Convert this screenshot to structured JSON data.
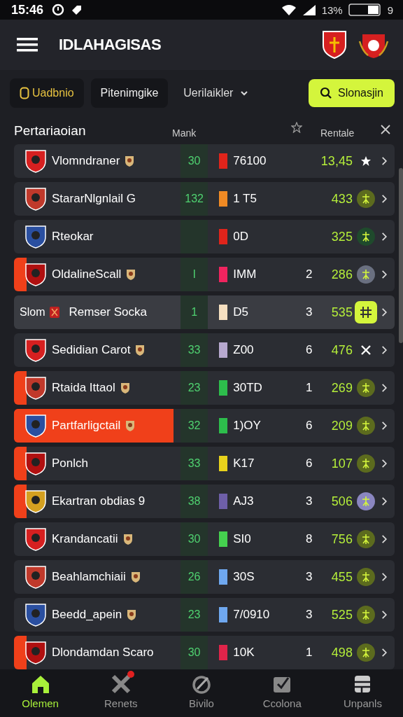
{
  "status_bar": {
    "time": "15:46",
    "battery_percent": "13%",
    "battery_digit": "9"
  },
  "header": {
    "title": "IDLAHAGISAS"
  },
  "filters": [
    {
      "label": "Uadbnio",
      "selected": true,
      "kind": "chip"
    },
    {
      "label": "Pitenimgike",
      "selected": false,
      "kind": "chip"
    },
    {
      "label": "Uerilaikler",
      "selected": false,
      "kind": "dropdown"
    },
    {
      "label": "Slonasjin",
      "selected": false,
      "kind": "search"
    }
  ],
  "table": {
    "title": "Pertariaoian",
    "columns": [
      "Mank",
      "Rentale"
    ],
    "rows": [
      {
        "kind": "team",
        "name": "Vlomndraner",
        "badge": true,
        "score": "30",
        "color": "#e0241b",
        "code": "76100",
        "count": "",
        "points": "13,45",
        "status": {
          "kind": "star",
          "color": "#ffffff"
        },
        "accent": false,
        "selected": false
      },
      {
        "kind": "team",
        "name": "StararNlgnlail G",
        "badge": false,
        "score": "132",
        "color": "#f08a24",
        "code": "1 T5",
        "count": "",
        "points": "433",
        "status": {
          "kind": "dot",
          "color": "#5c6b1e"
        },
        "accent": false,
        "selected": false
      },
      {
        "kind": "team",
        "name": "Rteokar",
        "badge": false,
        "score": "",
        "color": "#e0241b",
        "code": "0D",
        "count": "",
        "points": "325",
        "status": {
          "kind": "dot",
          "color": "#1f4a2c"
        },
        "accent": false,
        "selected": false
      },
      {
        "kind": "team",
        "name": "OldalineScall",
        "badge": true,
        "score": "I",
        "color": "#f0245f",
        "code": "IMM",
        "count": "2",
        "points": "286",
        "status": {
          "kind": "dot",
          "color": "#6a7080"
        },
        "accent": true,
        "selected": false
      },
      {
        "kind": "sub",
        "prefix": "Slom",
        "name": "Remser Socka",
        "badge": true,
        "score": "1",
        "color": "#f5dfc0",
        "code": "D5",
        "count": "3",
        "points": "535",
        "status": {
          "kind": "square",
          "color": "#d4f53c"
        },
        "accent": false,
        "selected": false
      },
      {
        "kind": "team",
        "name": "Sedidian Carot",
        "badge": true,
        "score": "33",
        "color": "#b7a9cf",
        "code": "Z00",
        "count": "6",
        "points": "476",
        "status": {
          "kind": "cross",
          "color": "#ffffff"
        },
        "accent": false,
        "selected": false
      },
      {
        "kind": "team",
        "name": "Rtaida Ittaol",
        "badge": true,
        "score": "23",
        "color": "#2dbd4c",
        "code": "30TD",
        "count": "1",
        "points": "269",
        "status": {
          "kind": "dot",
          "color": "#5c6b1e"
        },
        "accent": true,
        "selected": false
      },
      {
        "kind": "team",
        "name": "Partfarligctail",
        "badge": true,
        "score": "32",
        "color": "#2dbd4c",
        "code": "1)OY",
        "count": "6",
        "points": "209",
        "status": {
          "kind": "dot",
          "color": "#5c6b1e"
        },
        "accent": true,
        "selected": true
      },
      {
        "kind": "team",
        "name": "Ponlch",
        "badge": false,
        "score": "33",
        "color": "#e8d21c",
        "code": "K17",
        "count": "6",
        "points": "107",
        "status": {
          "kind": "dot",
          "color": "#5c6b1e"
        },
        "accent": true,
        "selected": false
      },
      {
        "kind": "team",
        "name": "Ekartran obdias 9",
        "badge": false,
        "score": "38",
        "color": "#6e5fa8",
        "code": "AJ3",
        "count": "3",
        "points": "506",
        "status": {
          "kind": "dot",
          "color": "#8a86c0"
        },
        "accent": true,
        "selected": false
      },
      {
        "kind": "team",
        "name": "Krandancatii",
        "badge": true,
        "score": "30",
        "color": "#45d04f",
        "code": "SI0",
        "count": "8",
        "points": "756",
        "status": {
          "kind": "dot",
          "color": "#5c6b1e"
        },
        "accent": false,
        "selected": false
      },
      {
        "kind": "team",
        "name": "Beahlamchiaii",
        "badge": true,
        "score": "26",
        "color": "#6fa8f0",
        "code": "30S",
        "count": "3",
        "points": "455",
        "status": {
          "kind": "dot",
          "color": "#5c6b1e"
        },
        "accent": false,
        "selected": false
      },
      {
        "kind": "team",
        "name": "Beedd_apein",
        "badge": true,
        "score": "23",
        "color": "#6fa8f0",
        "code": "7/0910",
        "count": "3",
        "points": "525",
        "status": {
          "kind": "dot",
          "color": "#5c6b1e"
        },
        "accent": false,
        "selected": false
      },
      {
        "kind": "team",
        "name": "Dlondamdan Scaro",
        "badge": false,
        "score": "30",
        "color": "#e0244a",
        "code": "10K",
        "count": "1",
        "points": "498",
        "status": {
          "kind": "dot",
          "color": "#5c6b1e"
        },
        "accent": true,
        "selected": false
      }
    ]
  },
  "nav": [
    {
      "label": "Olemen",
      "selected": true,
      "badge": false
    },
    {
      "label": "Renets",
      "selected": false,
      "badge": true
    },
    {
      "label": "Bivilo",
      "selected": false,
      "badge": false
    },
    {
      "label": "Ccolona",
      "selected": false,
      "badge": false
    },
    {
      "label": "Unpanls",
      "selected": false,
      "badge": false
    }
  ]
}
